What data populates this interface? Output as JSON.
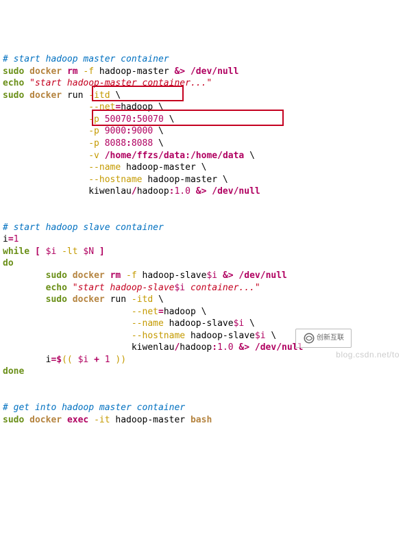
{
  "comments": {
    "c1": "# start hadoop master container",
    "c2": "# start hadoop slave container",
    "c3": "# get into hadoop master container"
  },
  "kw": {
    "sudo": "sudo",
    "echo": "echo",
    "while": "while",
    "do": "do",
    "done": "done"
  },
  "cmd": {
    "docker": "docker",
    "bash": "bash"
  },
  "tok": {
    "rm": "rm",
    "docker_f": "-f",
    "hmaster": "hadoop-master",
    "amp_gt": "&>",
    "slash": "/",
    "dev": "dev",
    "null": "null",
    "str_master": "\"start hadoop-master container...\"",
    "run": "run",
    "itd": "-itd",
    "bs": "\\",
    "net": "--net",
    "eq": "=",
    "hadoop": "hadoop",
    "p": "-p",
    "p1": "50070",
    "colon": ":",
    "p1b": "50070",
    "p2": "9000",
    "p2b": "9000",
    "p3": "8088",
    "p3b": "8088",
    "v": "-v",
    "home": "home",
    "ffzs": "ffzs",
    "data": "data",
    "name_opt": "--name",
    "hostname_opt": "--hostname",
    "kiwenlau": "kiwenlau",
    "ver": "1.0",
    "i_decl_l": "i",
    "i_decl_r": "1",
    "lb": "[",
    "rb": "]",
    "dollar_i": "$i",
    "lt": "-lt",
    "dollar_N": "$N",
    "hslave": "hadoop-slave",
    "str_slave_a": "\"start hadoop-slave",
    "str_slave_b": " container...\"",
    "i_inc_l": "i",
    "assign": "=$",
    "dlp": "((",
    "plus": "+",
    "one": "1",
    "drp": "))",
    "exec": "exec",
    "it": "-it"
  },
  "watermark": {
    "text": "blog.csdn.net/to",
    "logo": "创新互联"
  }
}
